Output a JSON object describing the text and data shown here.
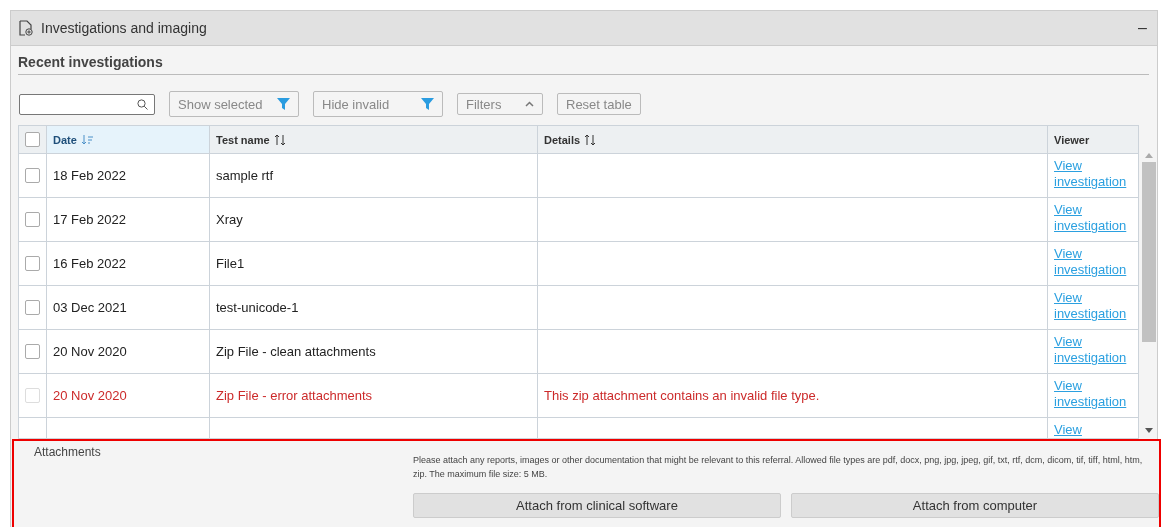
{
  "panel": {
    "title": "Investigations and imaging",
    "collapse_glyph": "–"
  },
  "section_title": "Recent investigations",
  "toolbar": {
    "buttons": [
      {
        "label": "Show selected",
        "kind": "filter"
      },
      {
        "label": "Hide invalid",
        "kind": "filter"
      },
      {
        "label": "Filters",
        "kind": "toggle"
      },
      {
        "label": "Reset table",
        "kind": "plain"
      }
    ]
  },
  "table": {
    "select_all": {
      "checked": false
    },
    "columns": [
      {
        "label": "Date",
        "sortable": true,
        "active": true
      },
      {
        "label": "Test name",
        "sortable": true,
        "active": false
      },
      {
        "label": "Details",
        "sortable": true,
        "active": false
      },
      {
        "label": "Viewer",
        "sortable": false,
        "active": false
      }
    ],
    "rows": [
      {
        "date": "18 Feb 2022",
        "test": "sample rtf",
        "link": "View investigation",
        "invalid": false,
        "checked": false
      },
      {
        "date": "17 Feb 2022",
        "test": "Xray",
        "link": "View investigation",
        "invalid": false,
        "checked": false
      },
      {
        "date": "16 Feb 2022",
        "test": "File1",
        "link": "View investigation",
        "invalid": false,
        "checked": false
      },
      {
        "date": "03 Dec 2021",
        "test": "test-unicode-1",
        "link": "View investigation",
        "invalid": false,
        "checked": false
      },
      {
        "date": "20 Nov 2020",
        "test": "Zip File - clean attachments",
        "link": "View investigation",
        "invalid": false,
        "checked": false
      },
      {
        "date": "20 Nov 2020",
        "test": "Zip File - error attachments",
        "details": "This zip attachment contains an invalid file type.",
        "link": "View investigation",
        "invalid": true,
        "checked": false
      },
      {
        "link": "View"
      }
    ]
  },
  "attachments": {
    "label": "Attachments",
    "help": "Please attach any reports, images or other documentation that might be relevant to this referral. Allowed file types are pdf, docx, png, jpg, jpeg, gif, txt, rtf, dcm, dicom, tif, tiff, html, htm, zip. The maximum file size: 5 MB.",
    "buttons": [
      "Attach from clinical software",
      "Attach from computer"
    ]
  }
}
